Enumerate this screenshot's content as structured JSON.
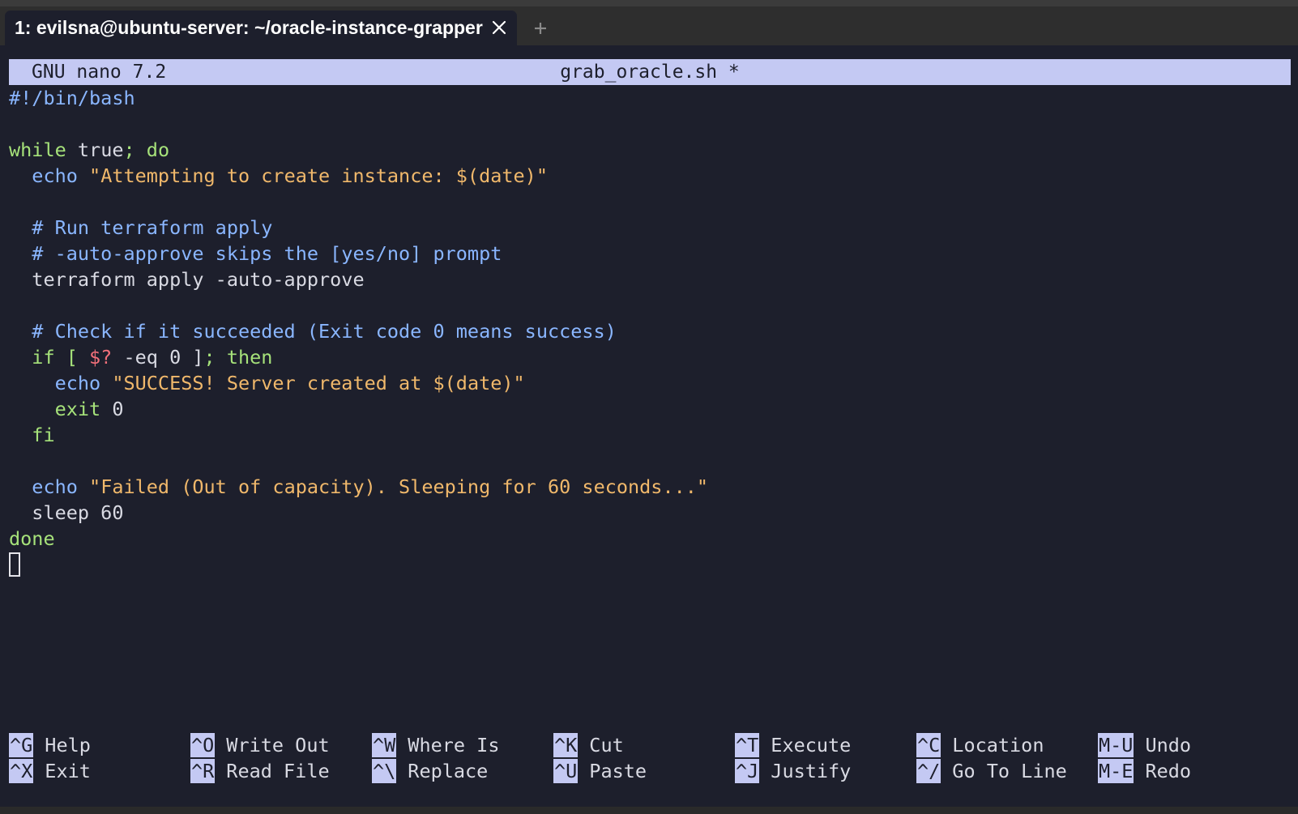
{
  "window": {
    "tab_title": "1: evilsna@ubuntu-server: ~/oracle-instance-grapper",
    "close_icon": "close-icon",
    "new_tab_icon": "plus-icon"
  },
  "nano": {
    "version": "GNU nano 7.2",
    "filename": "grab_oracle.sh *"
  },
  "code": {
    "shebang": "#!/bin/bash",
    "while_kw": "while",
    "while_cond": " true",
    "while_semi": "; do",
    "echo1_cmd": "echo",
    "echo1_str": "\"Attempting to create instance: $(date)\"",
    "comment1": "# Run terraform apply",
    "comment2": "# -auto-approve skips the [yes/no] prompt",
    "terraform_cmd": "terraform apply -auto-approve",
    "comment3": "# Check if it succeeded (Exit code 0 means success)",
    "if_kw": "if [",
    "if_var": " $?",
    "if_rest": " -eq 0 ]",
    "if_then": "; then",
    "echo2_cmd": "echo",
    "echo2_str": "\"SUCCESS! Server created at $(date)\"",
    "exit_kw": "exit",
    "exit_code": " 0",
    "fi_kw": "fi",
    "echo3_cmd": "echo",
    "echo3_str": "\"Failed (Out of capacity). Sleeping for 60 seconds...\"",
    "sleep_cmd": "sleep 60",
    "done_kw": "done"
  },
  "shortcuts": [
    [
      {
        "key": "^G",
        "label": "Help"
      },
      {
        "key": "^X",
        "label": "Exit"
      }
    ],
    [
      {
        "key": "^O",
        "label": "Write Out"
      },
      {
        "key": "^R",
        "label": "Read File"
      }
    ],
    [
      {
        "key": "^W",
        "label": "Where Is"
      },
      {
        "key": "^\\",
        "label": "Replace"
      }
    ],
    [
      {
        "key": "^K",
        "label": "Cut"
      },
      {
        "key": "^U",
        "label": "Paste"
      }
    ],
    [
      {
        "key": "^T",
        "label": "Execute"
      },
      {
        "key": "^J",
        "label": "Justify"
      }
    ],
    [
      {
        "key": "^C",
        "label": "Location"
      },
      {
        "key": "^/",
        "label": "Go To Line"
      }
    ],
    [
      {
        "key": "M-U",
        "label": "Undo"
      },
      {
        "key": "M-E",
        "label": "Redo"
      }
    ]
  ],
  "colors": {
    "background": "#1d1f2c",
    "title_bar": "#c4c9f3",
    "keyword": "#a6e27a",
    "comment": "#8ab6ff",
    "string": "#f0b86b",
    "variable": "#f2707a",
    "text": "#d9dae3"
  }
}
